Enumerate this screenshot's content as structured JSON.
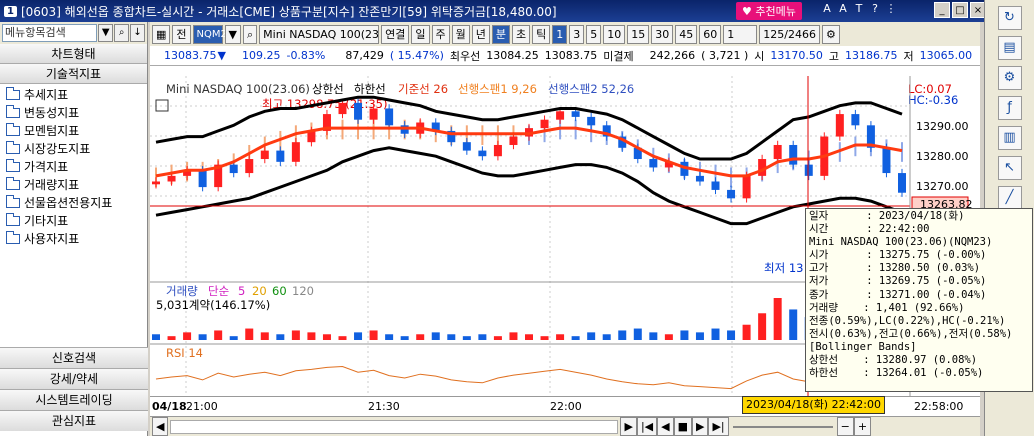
{
  "window": {
    "num": "1",
    "title": "[0603] 해외선옵 종합차트-실시간 - 거래소[CME] 상품구분[지수] 잔존만기[59] 위탁증거금[18,480.00]",
    "menu_button": "추천메뉴"
  },
  "left": {
    "search_placeholder": "메뉴항목검색",
    "chart_type": "차트형태",
    "tech_indicator": "기술적지표",
    "tree": [
      "추세지표",
      "변동성지표",
      "모멘텀지표",
      "시장강도지표",
      "가격지표",
      "거래량지표",
      "선물옵션전용지표",
      "기타지표",
      "사용자지표"
    ],
    "bottom": [
      "신호검색",
      "강세/약세",
      "시스템트레이딩",
      "관심지표"
    ]
  },
  "toolbar": {
    "jeon": "전",
    "code": "NQM23",
    "product": "Mini NASDAQ 100(23.0",
    "periods": [
      "연결",
      "일",
      "주",
      "월",
      "년",
      "분",
      "초",
      "틱"
    ],
    "selected_period": "분",
    "intervals": [
      "1",
      "3",
      "5",
      "10",
      "15",
      "30",
      "45",
      "60"
    ],
    "selected_interval": "1",
    "count_select": "1",
    "paging": "125/2466"
  },
  "quote": {
    "price": "13083.75",
    "change": "109.25",
    "pct": "-0.83%",
    "volume": "87,429",
    "volume_pct": "( 15.47%)",
    "best_ask_label": "최우선",
    "best_ask": "13084.25",
    "best_bid": "13083.75",
    "open_int_label": "미결제",
    "open_int": "242,266",
    "open_int_chg": "( 3,721 )",
    "open_label": "시",
    "open": "13170.50",
    "high_label": "고",
    "high": "13186.75",
    "low_label": "저",
    "low": "13065.00"
  },
  "chart": {
    "legend_title": "Mini NASDAQ 100(23.06)",
    "legend_upper": "상한선",
    "legend_lower": "하한선",
    "legend_base": "기준선 26",
    "legend_span1": "선행스팬1 9,26",
    "legend_span2": "선행스팬2 52,26",
    "high_label": "최고 13298.75 (21:35)",
    "low_label": "최저 13",
    "lc": "LC:0.07",
    "hc": "HC:-0.36",
    "price_ticks": [
      "13290.00",
      "13280.00",
      "13270.00"
    ],
    "current_price_label": "13263.82",
    "volume_legend": "거래량",
    "volume_simple": "단순",
    "ma5": "5",
    "ma20": "20",
    "ma60": "60",
    "ma120": "120",
    "volume_text": "5,031계약(146.17%)",
    "rsi_legend": "RSI 14",
    "time_date": "04/18",
    "time_ticks": [
      "21:00",
      "21:30",
      "22:00",
      "22:58:00"
    ],
    "cursor_time": "2023/04/18(화) 22:42:00"
  },
  "tooltip": [
    "일자      : 2023/04/18(화)",
    "시간      : 22:42:00",
    "Mini NASDAQ 100(23.06)(NQM23)",
    "시가      : 13275.75 (-0.00%)",
    "고가      : 13280.50 (0.03%)",
    "저가      : 13269.75 (-0.05%)",
    "종가      : 13271.00 (-0.04%)",
    "거래량    : 1,401 (92.66%)",
    "전종(0.59%),LC(0.22%),HC(-0.21%)",
    "전시(0.63%),전고(0.66%),전저(0.58%)",
    "[Bollinger Bands]",
    "상한선    : 13280.97 (0.08%)",
    "하한선    : 13264.01 (-0.05%)"
  ],
  "chart_data": {
    "type": "line",
    "series_close": [
      13268,
      13270,
      13272,
      13266,
      13274,
      13271,
      13276,
      13279,
      13275,
      13282,
      13286,
      13292,
      13296,
      13290,
      13294,
      13288,
      13285,
      13289,
      13286,
      13282,
      13279,
      13277,
      13281,
      13284,
      13287,
      13290,
      13293,
      13291,
      13288,
      13284,
      13280,
      13276,
      13273,
      13275,
      13270,
      13268,
      13265,
      13262,
      13270,
      13276,
      13281,
      13274,
      13270,
      13284,
      13292,
      13288,
      13280,
      13271,
      13264
    ],
    "bb_upper": [
      13282,
      13283,
      13284,
      13284,
      13286,
      13288,
      13291,
      13293,
      13294,
      13294,
      13295,
      13296,
      13297,
      13298,
      13298,
      13297,
      13296,
      13295,
      13293,
      13292,
      13291,
      13290,
      13290,
      13291,
      13292,
      13293,
      13294,
      13294,
      13293,
      13292,
      13290,
      13287,
      13284,
      13281,
      13278,
      13276,
      13276,
      13276,
      13278,
      13282,
      13286,
      13290,
      13291,
      13293,
      13295,
      13296,
      13296,
      13294,
      13292
    ],
    "bb_lower": [
      13256,
      13257,
      13258,
      13259,
      13260,
      13261,
      13262,
      13264,
      13266,
      13268,
      13270,
      13272,
      13275,
      13277,
      13279,
      13280,
      13279,
      13278,
      13277,
      13275,
      13273,
      13271,
      13270,
      13270,
      13271,
      13272,
      13273,
      13274,
      13274,
      13273,
      13271,
      13268,
      13264,
      13261,
      13259,
      13257,
      13255,
      13253,
      13253,
      13255,
      13257,
      13259,
      13260,
      13261,
      13262,
      13262,
      13261,
      13259,
      13257
    ],
    "base_line": [
      13270,
      13271,
      13272,
      13272,
      13273,
      13275,
      13278,
      13281,
      13283,
      13285,
      13286,
      13287,
      13287,
      13287,
      13287,
      13287,
      13287,
      13287,
      13286,
      13285,
      13285,
      13285,
      13285,
      13285,
      13285,
      13286,
      13287,
      13287,
      13286,
      13285,
      13283,
      13280,
      13277,
      13275,
      13273,
      13272,
      13271,
      13270,
      13270,
      13272,
      13275,
      13276,
      13276,
      13277,
      13279,
      13281,
      13281,
      13280,
      13279
    ],
    "ylim": [
      13255,
      13302
    ],
    "volume": [
      3,
      2,
      4,
      3,
      5,
      2,
      6,
      4,
      3,
      5,
      4,
      3,
      2,
      4,
      5,
      3,
      2,
      3,
      4,
      3,
      2,
      3,
      2,
      4,
      3,
      2,
      3,
      2,
      4,
      3,
      5,
      6,
      4,
      3,
      5,
      4,
      6,
      5,
      8,
      14,
      22,
      16,
      12,
      18,
      20,
      15,
      10,
      8,
      12
    ],
    "rsi": [
      48,
      52,
      55,
      46,
      60,
      52,
      58,
      62,
      55,
      65,
      68,
      72,
      74,
      62,
      66,
      55,
      50,
      58,
      54,
      46,
      42,
      40,
      50,
      56,
      60,
      64,
      68,
      62,
      56,
      48,
      42,
      38,
      36,
      40,
      34,
      32,
      30,
      28,
      44,
      56,
      62,
      48,
      42,
      62,
      70,
      60,
      46,
      36,
      30
    ]
  }
}
